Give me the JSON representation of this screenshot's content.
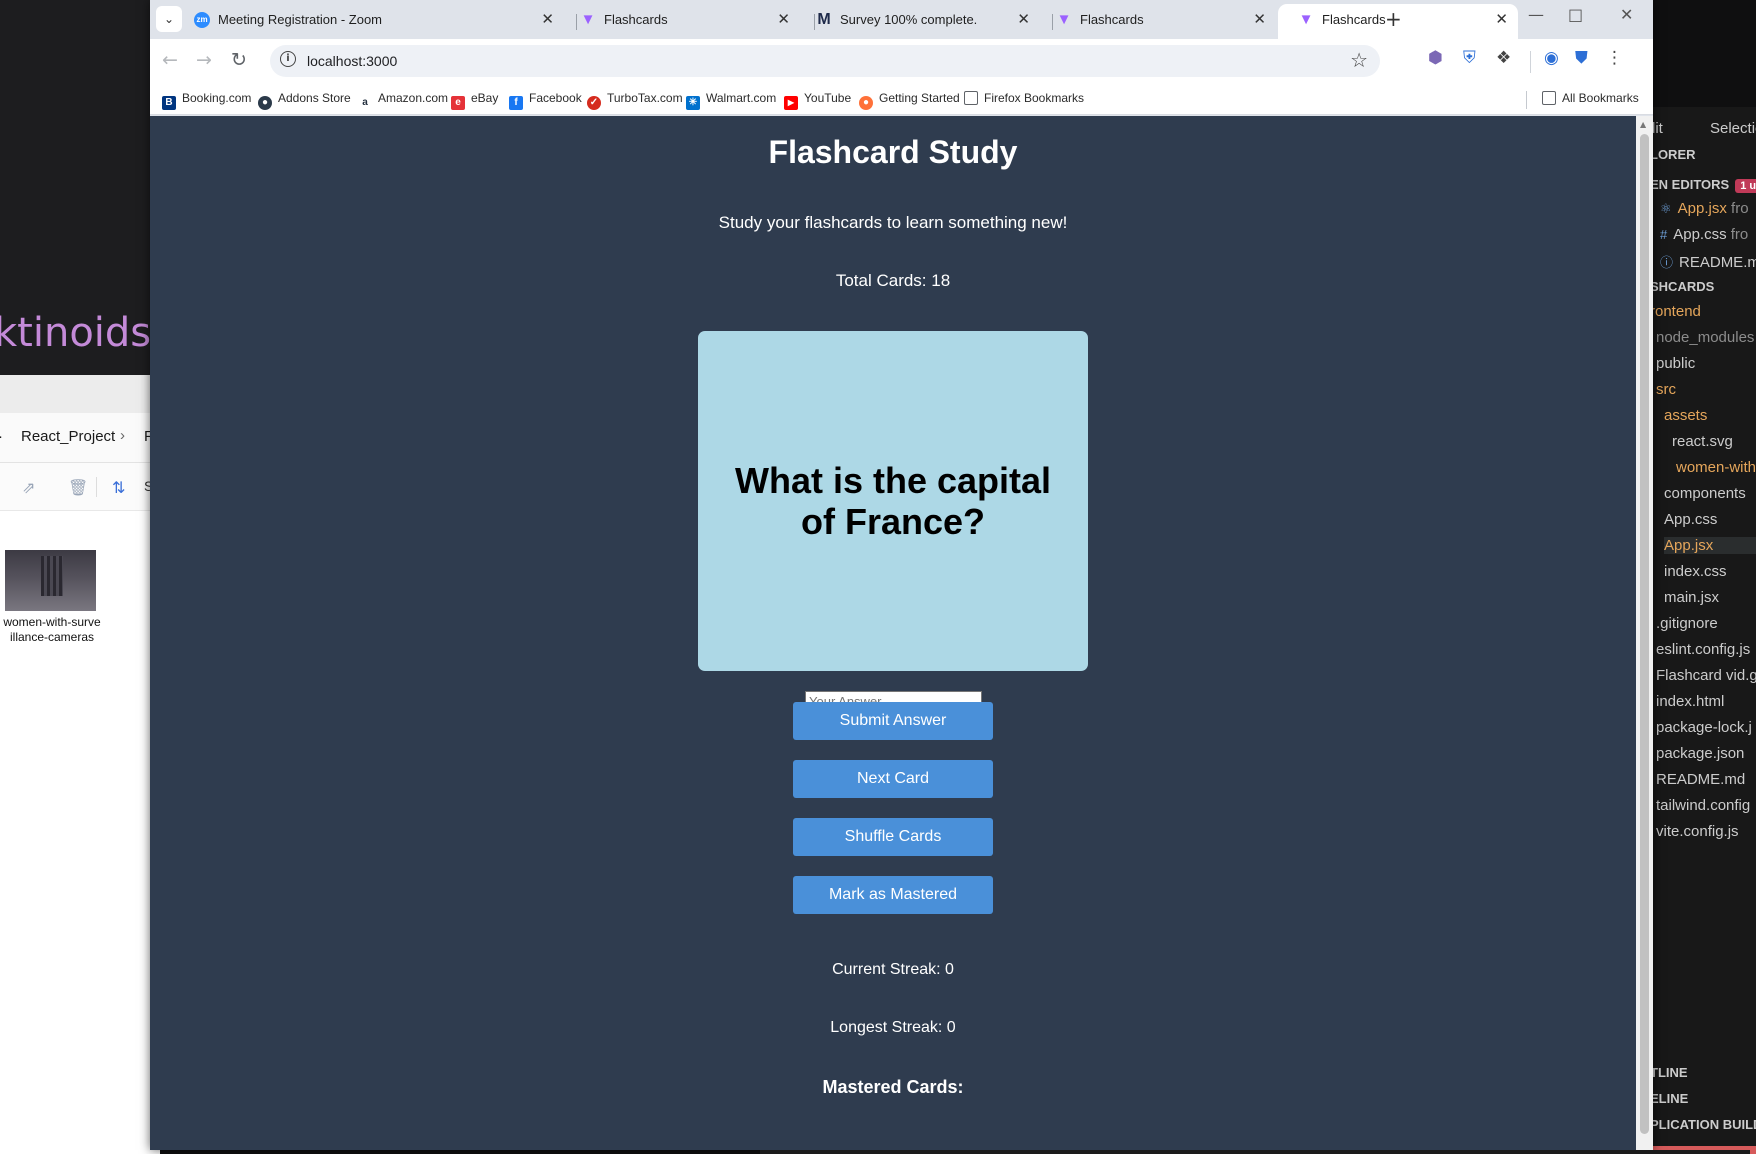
{
  "background": {
    "wallpaper_text": "ktinoids",
    "explorer": {
      "breadcrumb": [
        "·",
        "React_Project",
        "›",
        "F"
      ],
      "sort_label": "S",
      "file_name": "women-with-surveillance-cameras"
    },
    "vscode": {
      "menu": [
        "dit",
        "Selection"
      ],
      "explorer_header": "LORER",
      "open_editors_header": "EN EDITORS",
      "open_editors_badge": "1 u",
      "open_editors": [
        {
          "name": "App.jsx",
          "suffix": "fro"
        },
        {
          "name": "App.css",
          "suffix": "fro"
        },
        {
          "name": "README.m",
          "suffix": ""
        }
      ],
      "project_header": "SHCARDS",
      "tree": [
        "rontend",
        "node_modules",
        "public",
        "src",
        "assets",
        "react.svg",
        "women-with",
        "components",
        "App.css",
        "App.jsx",
        "index.css",
        "main.jsx",
        ".gitignore",
        "eslint.config.js",
        "Flashcard vid.g",
        "index.html",
        "package-lock.j",
        "package.json",
        "README.md",
        "tailwind.config",
        "vite.config.js"
      ],
      "bottom_sections": [
        "TLINE",
        "ELINE",
        "PLICATION BUILD"
      ]
    }
  },
  "browser": {
    "tabs": [
      {
        "title": "Meeting Registration - Zoom",
        "favicon": "zoom-icon",
        "active": false
      },
      {
        "title": "Flashcards",
        "favicon": "vite-icon",
        "active": false
      },
      {
        "title": "Survey 100% complete.",
        "favicon": "m-logo-icon",
        "active": false
      },
      {
        "title": "Flashcards",
        "favicon": "vite-icon",
        "active": false
      },
      {
        "title": "Flashcards",
        "favicon": "vite-icon",
        "active": true
      }
    ],
    "url": "localhost:3000",
    "bookmarks": [
      {
        "label": "Booking.com",
        "icon": "booking-icon",
        "color": "#003580"
      },
      {
        "label": "Addons Store",
        "icon": "addons-icon",
        "color": "#2b3a4a"
      },
      {
        "label": "Amazon.com",
        "icon": "amazon-icon",
        "color": "#232f3e"
      },
      {
        "label": "eBay",
        "icon": "ebay-icon",
        "color": "#e53238"
      },
      {
        "label": "Facebook",
        "icon": "facebook-icon",
        "color": "#1877f2"
      },
      {
        "label": "TurboTax.com",
        "icon": "turbotax-icon",
        "color": "#d52b1e"
      },
      {
        "label": "Walmart.com",
        "icon": "walmart-icon",
        "color": "#0071ce"
      },
      {
        "label": "YouTube",
        "icon": "youtube-icon",
        "color": "#ff0000"
      },
      {
        "label": "Getting Started",
        "icon": "firefox-icon",
        "color": "#ff7139"
      },
      {
        "label": "Firefox Bookmarks",
        "icon": "folder-icon",
        "color": "#5f6368"
      }
    ],
    "all_bookmarks_label": "All Bookmarks"
  },
  "app": {
    "title": "Flashcard Study",
    "subtitle": "Study your flashcards to learn something new!",
    "total_cards": "Total Cards: 18",
    "card_question": "What is the capital of France?",
    "answer_placeholder": "Your Answer",
    "buttons": {
      "submit": "Submit Answer",
      "next": "Next Card",
      "shuffle": "Shuffle Cards",
      "mastered": "Mark as Mastered"
    },
    "current_streak": "Current Streak: 0",
    "longest_streak": "Longest Streak: 0",
    "mastered_heading": "Mastered Cards:"
  },
  "colors": {
    "page_background": "#2f3c4f",
    "card_background": "#add8e6",
    "button": "#4a90d9"
  }
}
